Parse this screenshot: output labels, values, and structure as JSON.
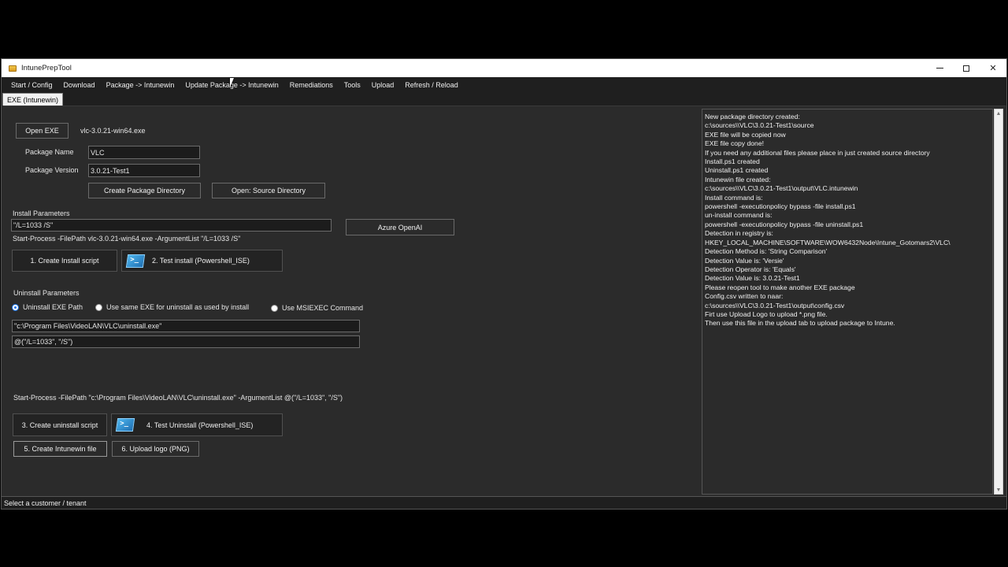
{
  "window": {
    "title": "IntunePrepTool",
    "controls": {
      "minimize": "",
      "maximize": "",
      "close": "✕"
    }
  },
  "menu": [
    "Start / Config",
    "Download",
    "Package -> Intunewin",
    "Update Package -> Intunewin",
    "Remediations",
    "Tools",
    "Upload",
    "Refresh / Reload"
  ],
  "tab": {
    "label": "EXE (Intunewin)"
  },
  "package": {
    "open_exe_label": "Open EXE",
    "exe_filename": "vlc-3.0.21-win64.exe",
    "name_label": "Package Name",
    "name_value": "VLC",
    "version_label": "Package Version",
    "version_value": "3.0.21-Test1",
    "create_dir_label": "Create Package Directory",
    "open_source_label": "Open: Source Directory"
  },
  "install": {
    "section_label": "Install Parameters",
    "params_value": "\"/L=1033 /S\"",
    "command_preview": "Start-Process -FilePath vlc-3.0.21-win64.exe -ArgumentList \"/L=1033 /S\"",
    "azure_label": "Azure OpenAI",
    "create_script_label": "1. Create Install script",
    "test_install_label": "2. Test install (Powershell_ISE)"
  },
  "uninstall": {
    "section_label": "Uninstall Parameters",
    "radio_exe_path": "Uninstall EXE Path",
    "radio_same_exe": "Use same EXE for uninstall as used by install",
    "radio_msiexec": "Use MSIEXEC Command",
    "selected_option": "Uninstall EXE Path",
    "path_value": "\"c:\\Program Files\\VideoLAN\\VLC\\uninstall.exe\"",
    "args_value": "@(\"/L=1033\", \"/S\")",
    "command_preview": "Start-Process -FilePath \"c:\\Program Files\\VideoLAN\\VLC\\uninstall.exe\" -ArgumentList @(\"/L=1033\", \"/S\")",
    "create_script_label": "3. Create uninstall script",
    "test_uninstall_label": "4. Test Uninstall (Powershell_ISE)",
    "create_intunewin_label": "5. Create Intunewin file",
    "upload_logo_label": "6. Upload logo (PNG)"
  },
  "log": [
    "New package directory created:",
    "c:\\sources\\\\VLC\\3.0.21-Test1\\source",
    "EXE file will be copied now",
    "EXE file copy done!",
    "If you need any additional files please place in just created source directory",
    "Install.ps1 created",
    "Uninstall.ps1 created",
    "Intunewin file created:",
    "c:\\sources\\\\VLC\\3.0.21-Test1\\output\\VLC.intunewin",
    "Install command is:",
    "powershell -executionpolicy bypass -file install.ps1",
    "un-install command is:",
    "powershell -executionpolicy bypass -file uninstall.ps1",
    "Detection in registry is:",
    "HKEY_LOCAL_MACHINE\\SOFTWARE\\WOW6432Node\\Intune_Gotomars2\\VLC\\",
    "Detection Method is: 'String Comparison'",
    "Detection Value is: 'Versie'",
    "Detection Operator is: 'Equals'",
    "Detection Value is: 3.0.21-Test1",
    "Please reopen tool to make another EXE package",
    "Config.csv written to naar:",
    "c:\\sources\\\\VLC\\3.0.21-Test1\\output\\config.csv",
    "Firt use Upload Logo to upload *.png file.",
    "Then use this file in the upload tab to upload package to Intune."
  ],
  "status": {
    "text": "Select a customer / tenant"
  },
  "icons": {
    "app": "app-folder-icon",
    "powershell": "powershell-icon",
    "scroll_up": "▲",
    "scroll_down": "▼"
  }
}
